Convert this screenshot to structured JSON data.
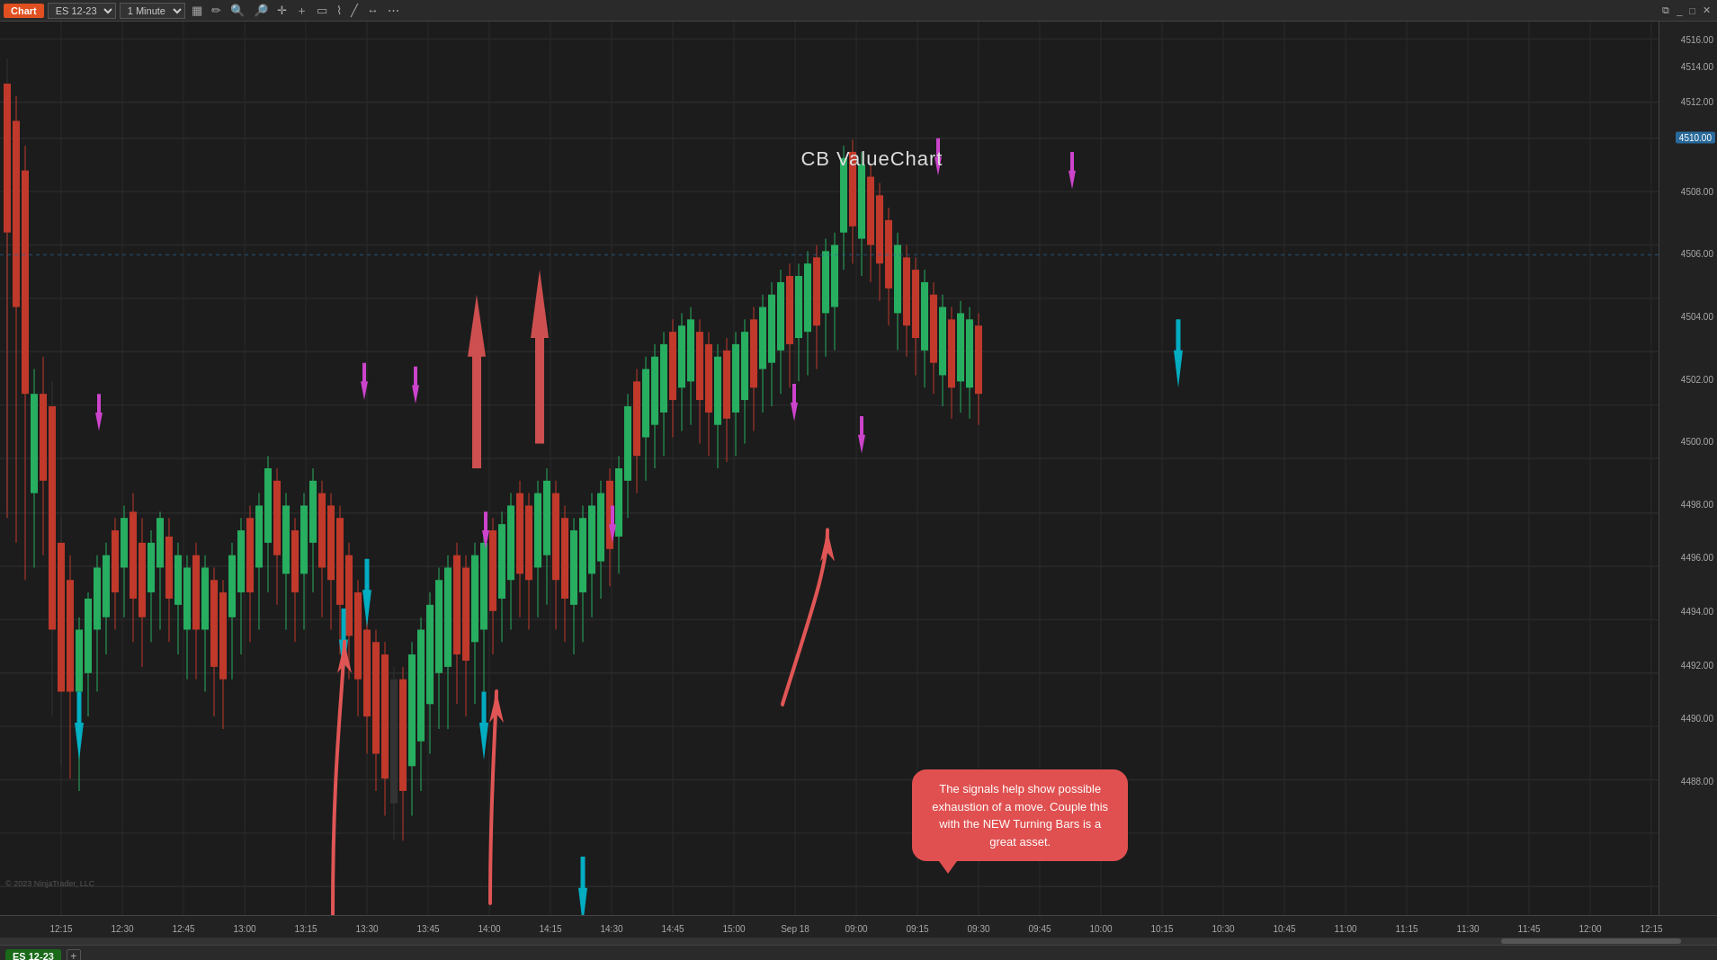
{
  "toolbar": {
    "chart_label": "Chart",
    "instrument": "ES 12-23",
    "timeframe": "1 Minute",
    "icons": [
      "bar-chart-icon",
      "pencil-icon",
      "magnify-icon",
      "crosshair-icon",
      "plus-icon",
      "rectangle-icon",
      "fibonacci-icon",
      "trendline-icon",
      "measure-icon",
      "toolbar-more-icon"
    ]
  },
  "chart": {
    "title": "CB ValueChart",
    "price_levels": [
      {
        "price": "4516.00",
        "pct": 2
      },
      {
        "price": "4514.00",
        "pct": 5
      },
      {
        "price": "4512.00",
        "pct": 9
      },
      {
        "price": "4510.00",
        "pct": 13,
        "current": true
      },
      {
        "price": "4508.00",
        "pct": 19
      },
      {
        "price": "4506.00",
        "pct": 26
      },
      {
        "price": "4504.00",
        "pct": 33
      },
      {
        "price": "4502.00",
        "pct": 40
      },
      {
        "price": "4500.00",
        "pct": 47
      },
      {
        "price": "4498.00",
        "pct": 54
      },
      {
        "price": "4496.00",
        "pct": 60
      },
      {
        "price": "4494.00",
        "pct": 66
      },
      {
        "price": "4492.00",
        "pct": 72
      },
      {
        "price": "4490.00",
        "pct": 78
      },
      {
        "price": "4488.00",
        "pct": 85
      }
    ],
    "time_labels": [
      "12:15",
      "12:30",
      "12:45",
      "13:00",
      "13:15",
      "13:30",
      "13:45",
      "14:00",
      "14:15",
      "14:30",
      "14:45",
      "15:00",
      "Sep 18",
      "09:00",
      "09:15",
      "09:30",
      "09:45",
      "10:00",
      "10:15",
      "10:30",
      "10:45",
      "11:00",
      "11:15",
      "11:30",
      "11:45",
      "12:00",
      "12:15"
    ],
    "current_price": "4510.00",
    "callout_text": "The signals help show possible exhaustion of a move.  Couple this with the NEW Turning Bars is a great asset.",
    "copyright": "© 2023 NinjaTrader, LLC"
  },
  "bottom_bar": {
    "instrument_tab": "ES 12-23",
    "add_label": "+"
  }
}
